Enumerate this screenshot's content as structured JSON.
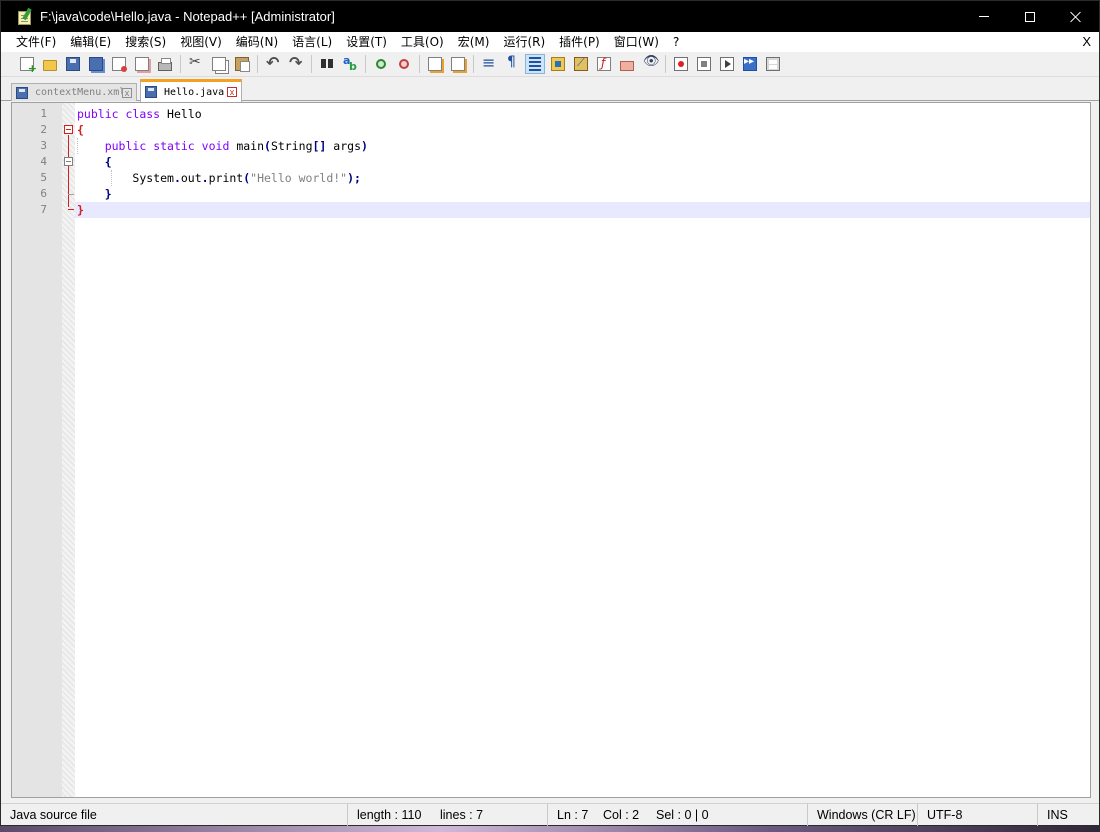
{
  "window": {
    "title": "F:\\java\\code\\Hello.java - Notepad++ [Administrator]"
  },
  "menu": {
    "items": [
      "文件(F)",
      "编辑(E)",
      "搜索(S)",
      "视图(V)",
      "编码(N)",
      "语言(L)",
      "设置(T)",
      "工具(O)",
      "宏(M)",
      "运行(R)",
      "插件(P)",
      "窗口(W)",
      "?"
    ],
    "close_label": "X"
  },
  "tabs": [
    {
      "label": "contextMenu.xml",
      "active": false
    },
    {
      "label": "Hello.java",
      "active": true
    }
  ],
  "tab_close_glyph": "x",
  "editor": {
    "line_numbers": [
      "1",
      "2",
      "3",
      "4",
      "5",
      "6",
      "7"
    ],
    "lines": {
      "l1_kw1": "public",
      "l1_kw2": "class",
      "l1_name": "Hello",
      "l2_brace": "{",
      "l3_kw1": "public",
      "l3_kw2": "static",
      "l3_kw3": "void",
      "l3_method": "main",
      "l3_paren_open": "(",
      "l3_type": "String",
      "l3_brackets": "[]",
      "l3_arg": "args",
      "l3_paren_close": ")",
      "l4_brace": "{",
      "l5_obj": "System",
      "l5_dot1": ".",
      "l5_field": "out",
      "l5_dot2": ".",
      "l5_method": "print",
      "l5_paren_open": "(",
      "l5_string": "\"Hello world!\"",
      "l5_paren_close": ")",
      "l5_semicolon": ";",
      "l6_brace": "}",
      "l7_brace": "}"
    },
    "current_line": 7,
    "colors": {
      "keyword": "#8000ff",
      "string": "#808080",
      "operator": "#000080",
      "brace_match": "#d02020",
      "current_line_bg": "#e8e8ff"
    }
  },
  "status": {
    "file_type": "Java source file",
    "length": "length : 110",
    "lines": "lines : 7",
    "ln": "Ln : 7",
    "col": "Col : 2",
    "sel": "Sel : 0 | 0",
    "eol": "Windows (CR LF)",
    "encoding": "UTF-8",
    "mode": "INS"
  }
}
